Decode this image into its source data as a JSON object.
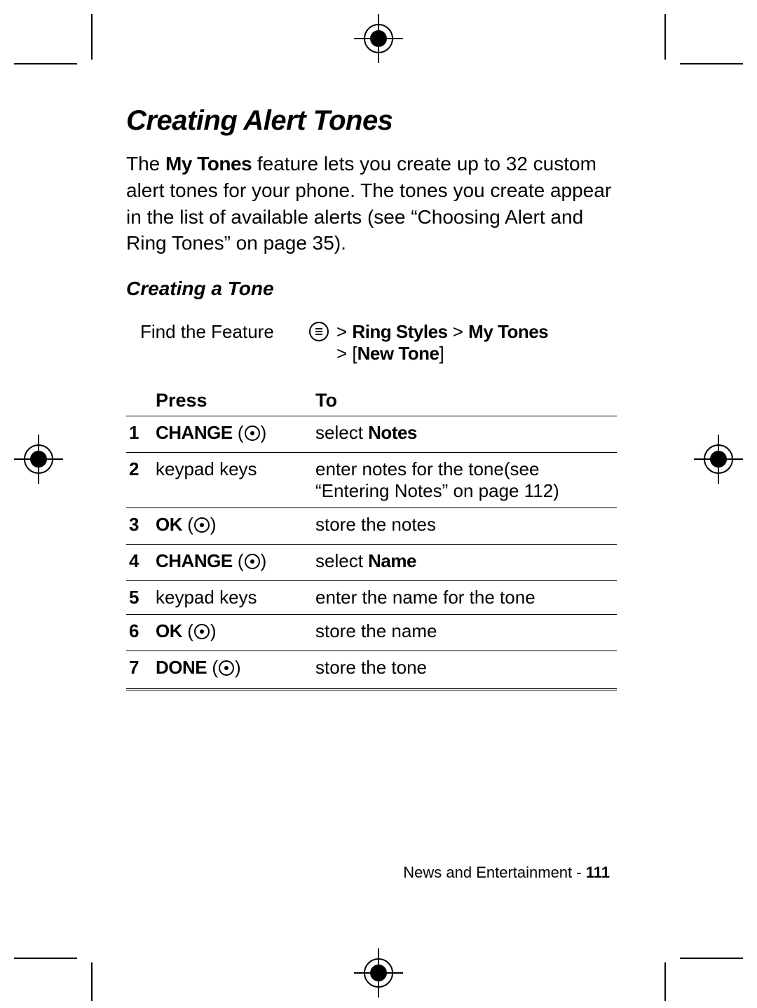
{
  "header": {
    "title": "Creating Alert Tones"
  },
  "intro": {
    "pre": "The ",
    "feature": "My Tones",
    "post": " feature lets you create up to 32 custom alert tones for your phone. The tones you create appear in the list of available alerts (see “Choosing Alert and Ring Tones” on page 35)."
  },
  "subsection": {
    "title": "Creating a Tone"
  },
  "feature_path": {
    "label": "Find the Feature",
    "line1_prefix": "> ",
    "line1_a": "Ring Styles",
    "line1_sep": " > ",
    "line1_b": "My Tones",
    "line2_prefix": "> ",
    "line2_bracket_open": "[",
    "line2_a": "New Tone",
    "line2_bracket_close": "]"
  },
  "table": {
    "head_press": "Press",
    "head_to": "To",
    "rows": [
      {
        "n": "1",
        "press_bold": "CHANGE",
        "press_plain": "",
        "to_pre": "select ",
        "to_bold": "Notes",
        "to_post": ""
      },
      {
        "n": "2",
        "press_bold": "",
        "press_plain": "keypad keys",
        "to_pre": "enter notes for the tone(see “Entering Notes” on page 112)",
        "to_bold": "",
        "to_post": ""
      },
      {
        "n": "3",
        "press_bold": "OK",
        "press_plain": "",
        "to_pre": "store the notes",
        "to_bold": "",
        "to_post": ""
      },
      {
        "n": "4",
        "press_bold": "CHANGE",
        "press_plain": "",
        "to_pre": "select ",
        "to_bold": "Name",
        "to_post": ""
      },
      {
        "n": "5",
        "press_bold": "",
        "press_plain": "keypad keys",
        "to_pre": "enter the name for the tone",
        "to_bold": "",
        "to_post": ""
      },
      {
        "n": "6",
        "press_bold": "OK",
        "press_plain": "",
        "to_pre": "store the name",
        "to_bold": "",
        "to_post": ""
      },
      {
        "n": "7",
        "press_bold": "DONE",
        "press_plain": "",
        "to_pre": "store the tone",
        "to_bold": "",
        "to_post": ""
      }
    ]
  },
  "footer": {
    "section": "News and Entertainment - ",
    "page": "111"
  }
}
